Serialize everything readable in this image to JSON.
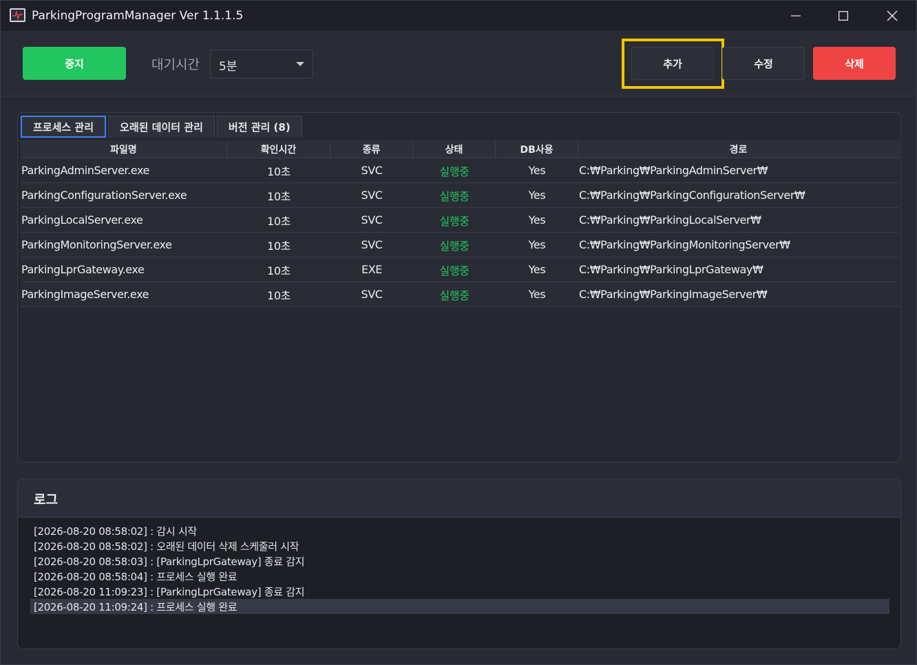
{
  "window": {
    "title": "ParkingProgramManager Ver 1.1.1.5"
  },
  "toolbar": {
    "stop_label": "중지",
    "wait_label": "대기시간",
    "wait_value": "5분",
    "add_label": "추가",
    "edit_label": "수정",
    "delete_label": "삭제"
  },
  "tabs": [
    {
      "label": "프로세스 관리",
      "active": true
    },
    {
      "label": "오래된 데이터 관리",
      "active": false
    },
    {
      "label": "버전 관리 (8)",
      "active": false
    }
  ],
  "grid": {
    "columns": [
      "파일명",
      "확인시간",
      "종류",
      "상태",
      "DB사용",
      "경로"
    ],
    "rows": [
      {
        "file": "ParkingAdminServer.exe",
        "interval": "10초",
        "type": "SVC",
        "status": "실행중",
        "db": "Yes",
        "path": "C:₩Parking₩ParkingAdminServer₩"
      },
      {
        "file": "ParkingConfigurationServer.exe",
        "interval": "10초",
        "type": "SVC",
        "status": "실행중",
        "db": "Yes",
        "path": "C:₩Parking₩ParkingConfigurationServer₩"
      },
      {
        "file": "ParkingLocalServer.exe",
        "interval": "10초",
        "type": "SVC",
        "status": "실행중",
        "db": "Yes",
        "path": "C:₩Parking₩ParkingLocalServer₩"
      },
      {
        "file": "ParkingMonitoringServer.exe",
        "interval": "10초",
        "type": "SVC",
        "status": "실행중",
        "db": "Yes",
        "path": "C:₩Parking₩ParkingMonitoringServer₩"
      },
      {
        "file": "ParkingLprGateway.exe",
        "interval": "10초",
        "type": "EXE",
        "status": "실행중",
        "db": "Yes",
        "path": "C:₩Parking₩ParkingLprGateway₩"
      },
      {
        "file": "ParkingImageServer.exe",
        "interval": "10초",
        "type": "SVC",
        "status": "실행중",
        "db": "Yes",
        "path": "C:₩Parking₩ParkingImageServer₩"
      }
    ]
  },
  "log": {
    "title": "로그",
    "lines": [
      "[2026-08-20 08:58:02] : 감시 시작",
      "[2026-08-20 08:58:02] : 오래된 데이터 삭제 스케줄러 시작",
      "[2026-08-20 08:58:03] : [ParkingLprGateway] 종료 감지",
      "[2026-08-20 08:58:04] : 프로세스 실행 완료",
      "[2026-08-20 11:09:23] : [ParkingLprGateway] 종료 감지",
      "[2026-08-20 11:09:24] : 프로세스 실행 완료"
    ],
    "selected_index": 5
  },
  "colors": {
    "stop": "#22c55e",
    "delete": "#ef4444",
    "highlight": "#f5c400",
    "running": "#22c55e",
    "active_tab_border": "#3b82f6"
  },
  "icons": [
    "app-monitor-icon",
    "minimize-icon",
    "maximize-icon",
    "close-icon",
    "dropdown-caret-icon"
  ]
}
